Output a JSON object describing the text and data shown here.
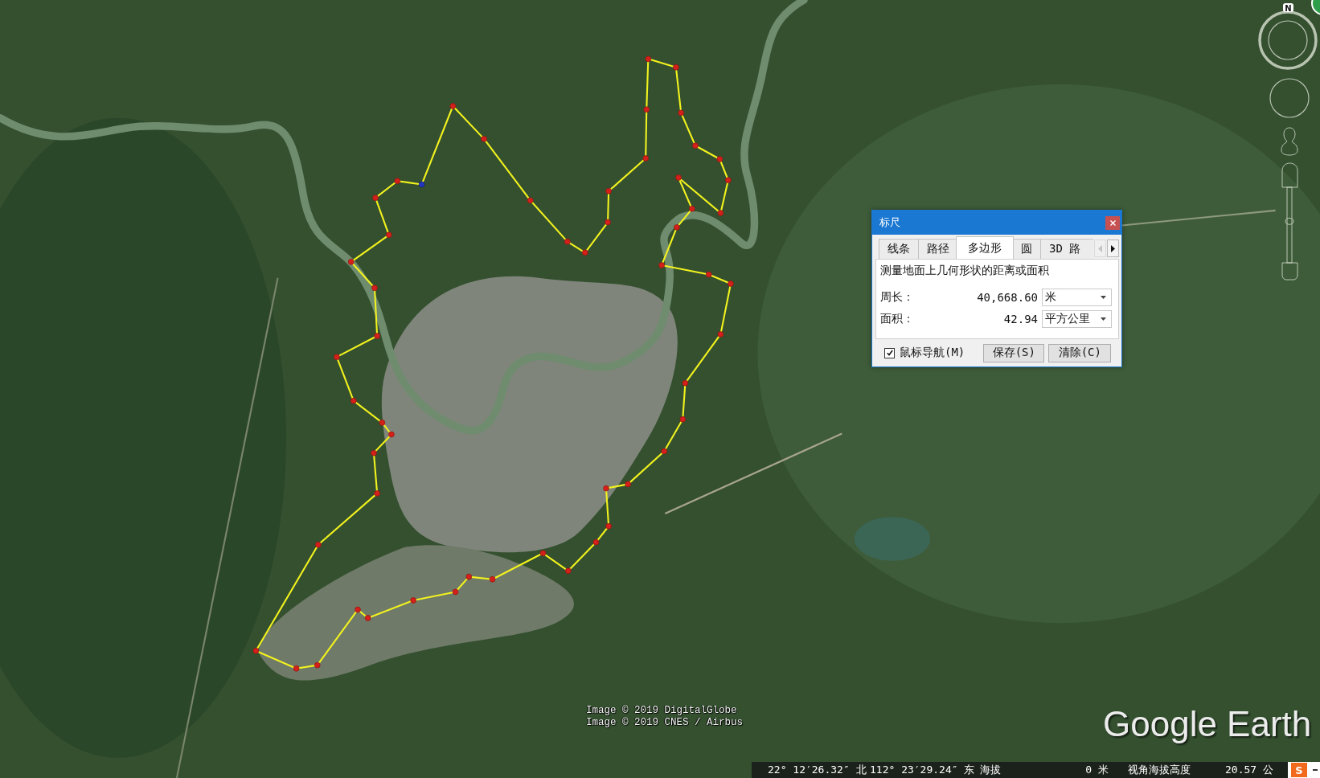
{
  "map": {
    "imagery_credits": [
      "Image © 2019 DigitalGlobe",
      "Image © 2019 CNES / Airbus"
    ],
    "logo": "Google Earth"
  },
  "navigation": {
    "compass_label": "N",
    "zoom_slider": {
      "level": 0.55
    }
  },
  "ruler_dialog": {
    "title": "标尺",
    "tabs": [
      {
        "label": "线条",
        "selected": false
      },
      {
        "label": "路径",
        "selected": false
      },
      {
        "label": "多边形",
        "selected": true
      },
      {
        "label": "圆",
        "selected": false
      },
      {
        "label": "3D 路",
        "selected": false
      }
    ],
    "tab_scroll_buttons": [
      {
        "kind": "left",
        "disabled": true
      },
      {
        "kind": "right",
        "disabled": false
      }
    ],
    "description": "测量地面上几何形状的距离或面积",
    "measurements": [
      {
        "label": "周长：",
        "value": "40,668.60",
        "unit": "米"
      },
      {
        "label": "面积：",
        "value": "42.94",
        "unit": "平方公里"
      }
    ],
    "mouse_navigation": {
      "label": "鼠标导航(M)",
      "checked": true
    },
    "buttons": [
      "保存(S)",
      "清除(C)"
    ]
  },
  "status_bar": {
    "latitude": "22° 12′26.32″ 北",
    "longitude": "112° 23′29.24″ 东",
    "elevation_label": "海拔",
    "elevation": "0 米",
    "eye_altitude_label": "视角海拔高度",
    "eye_altitude": "20.57 公",
    "input_method": "S"
  }
}
